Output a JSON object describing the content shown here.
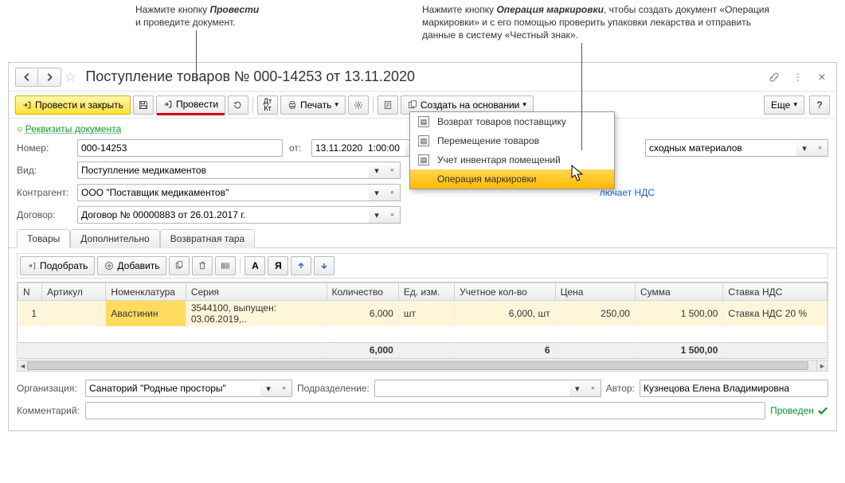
{
  "callouts": {
    "c1": "Нажмите кнопку <b><i>Провести</i></b><br>и проведите документ.",
    "c2": "Нажмите кнопку <b><i>Операция маркировки</i></b>, чтобы создать документ «Операция маркировки» и с его помощью проверить упаковки лекарства и отправить данные в систему «Честный знак»."
  },
  "title": "Поступление товаров № 000-14253 от 13.11.2020",
  "toolbar": {
    "post_and_close": "Провести и закрыть",
    "post": "Провести",
    "print": "Печать",
    "create_based": "Создать на основании",
    "more": "Еще",
    "help": "?"
  },
  "menu": {
    "items": [
      "Возврат товаров поставщику",
      "Перемещение товаров",
      "Учет инвентаря помещений",
      "Операция маркировки"
    ]
  },
  "form": {
    "requisites_link": "Реквизиты документа",
    "number_label": "Номер:",
    "number": "000-14253",
    "from_label": "от:",
    "date": "13.11.2020  1:00:00",
    "type_label": "Вид:",
    "type": "Поступление медикаментов",
    "counterparty_label": "Контрагент:",
    "counterparty": "ООО \"Поставщик медикаментов\"",
    "contract_label": "Договор:",
    "contract": "Договор № 00000883 от 26.01.2017 г.",
    "right_tail": "сходных материалов",
    "vat_hint": "лючает НДС"
  },
  "tabs": {
    "goods": "Товары",
    "extra": "Дополнительно",
    "tare": "Возвратная тара"
  },
  "inner_toolbar": {
    "pick": "Подобрать",
    "add": "Добавить"
  },
  "table": {
    "headers": {
      "n": "N",
      "article": "Артикул",
      "nomen": "Номенклатура",
      "series": "Серия",
      "qty": "Количество",
      "unit": "Ед. изм.",
      "acc_qty": "Учетное кол-во",
      "price": "Цена",
      "sum": "Сумма",
      "vat_rate": "Ставка НДС"
    },
    "row": {
      "n": "1",
      "article": "",
      "nomen": "Авастинин",
      "series": "3544100, выпущен: 03.06.2019,..",
      "qty": "6,000",
      "unit": "шт",
      "acc_qty": "6,000, шт",
      "price": "250,00",
      "sum": "1 500,00",
      "vat_rate": "Ставка НДС 20 %"
    },
    "totals": {
      "qty": "6,000",
      "acc_qty": "6",
      "sum": "1 500,00"
    }
  },
  "footer": {
    "org_label": "Организация:",
    "org": "Санаторий \"Родные просторы\"",
    "dept_label": "Подразделение:",
    "dept": "",
    "author_label": "Автор:",
    "author": "Кузнецова Елена Владимировна",
    "comment_label": "Комментарий:",
    "comment": "",
    "status": "Проведен"
  }
}
